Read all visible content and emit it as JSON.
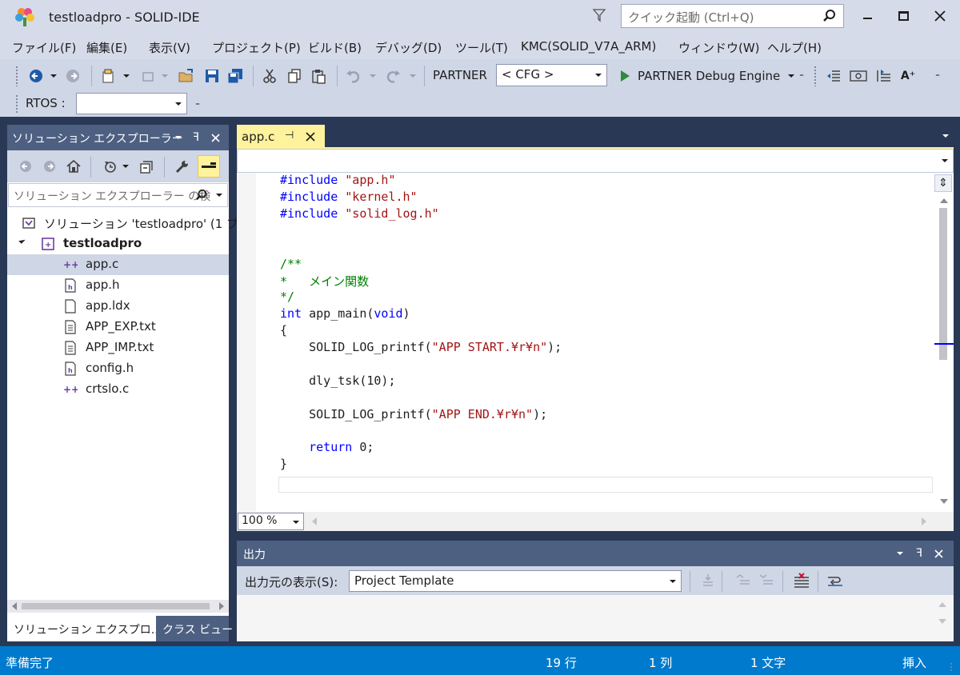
{
  "window": {
    "title": "testloadpro - SOLID-IDE",
    "quick_launch_placeholder": "クイック起動 (Ctrl+Q)"
  },
  "menu": [
    "ファイル(F)",
    "編集(E)",
    "表示(V)",
    "プロジェクト(P)",
    "ビルド(B)",
    "デバッグ(D)",
    "ツール(T)",
    "KMC(SOLID_V7A_ARM)",
    "ウィンドウ(W)",
    "ヘルプ(H)"
  ],
  "toolbar": {
    "partner_label": "PARTNER",
    "cfg_value": "< CFG >",
    "debug_engine_label": "PARTNER Debug Engine",
    "rtos_label": "RTOS :",
    "rtos_value": ""
  },
  "solution_explorer": {
    "title": "ソリューション エクスプローラー",
    "search_placeholder": "ソリューション エクスプローラー の検",
    "solution_label": "ソリューション 'testloadpro' (1 プロ",
    "project_label": "testloadpro",
    "files": [
      {
        "name": "app.c",
        "type": "c",
        "selected": true
      },
      {
        "name": "app.h",
        "type": "h",
        "selected": false
      },
      {
        "name": "app.ldx",
        "type": "doc",
        "selected": false
      },
      {
        "name": "APP_EXP.txt",
        "type": "txt",
        "selected": false
      },
      {
        "name": "APP_IMP.txt",
        "type": "txt",
        "selected": false
      },
      {
        "name": "config.h",
        "type": "h",
        "selected": false
      },
      {
        "name": "crtslo.c",
        "type": "c",
        "selected": false
      }
    ],
    "tabs": [
      "ソリューション エクスプロ...",
      "クラス ビュー"
    ]
  },
  "editor": {
    "tab_label": "app.c",
    "zoom": "100 %",
    "code_lines": [
      [
        {
          "t": "#include ",
          "c": "kw"
        },
        {
          "t": "\"app.h\"",
          "c": "str"
        }
      ],
      [
        {
          "t": "#include ",
          "c": "kw"
        },
        {
          "t": "\"kernel.h\"",
          "c": "str"
        }
      ],
      [
        {
          "t": "#include ",
          "c": "kw"
        },
        {
          "t": "\"solid_log.h\"",
          "c": "str"
        }
      ],
      [],
      [],
      [
        {
          "t": "/**",
          "c": "cm"
        }
      ],
      [
        {
          "t": "*   メイン関数",
          "c": "cm"
        }
      ],
      [
        {
          "t": "*/",
          "c": "cm"
        }
      ],
      [
        {
          "t": "int",
          "c": "kw"
        },
        {
          "t": " app_main(",
          "c": ""
        },
        {
          "t": "void",
          "c": "kw"
        },
        {
          "t": ")",
          "c": ""
        }
      ],
      [
        {
          "t": "{",
          "c": ""
        }
      ],
      [
        {
          "t": "    SOLID_LOG_printf(",
          "c": ""
        },
        {
          "t": "\"APP START.¥r¥n\"",
          "c": "str"
        },
        {
          "t": ");",
          "c": ""
        }
      ],
      [],
      [
        {
          "t": "    dly_tsk(10);",
          "c": ""
        }
      ],
      [],
      [
        {
          "t": "    SOLID_LOG_printf(",
          "c": ""
        },
        {
          "t": "\"APP END.¥r¥n\"",
          "c": "str"
        },
        {
          "t": ");",
          "c": ""
        }
      ],
      [],
      [
        {
          "t": "    ",
          "c": ""
        },
        {
          "t": "return",
          "c": "kw"
        },
        {
          "t": " 0;",
          "c": ""
        }
      ],
      [
        {
          "t": "}",
          "c": ""
        }
      ]
    ]
  },
  "output": {
    "title": "出力",
    "source_label": "出力元の表示(S):",
    "source_value": "Project Template"
  },
  "status": {
    "ready": "準備完了",
    "line": "19 行",
    "col": "1 列",
    "char": "1 文字",
    "mode": "挿入"
  }
}
